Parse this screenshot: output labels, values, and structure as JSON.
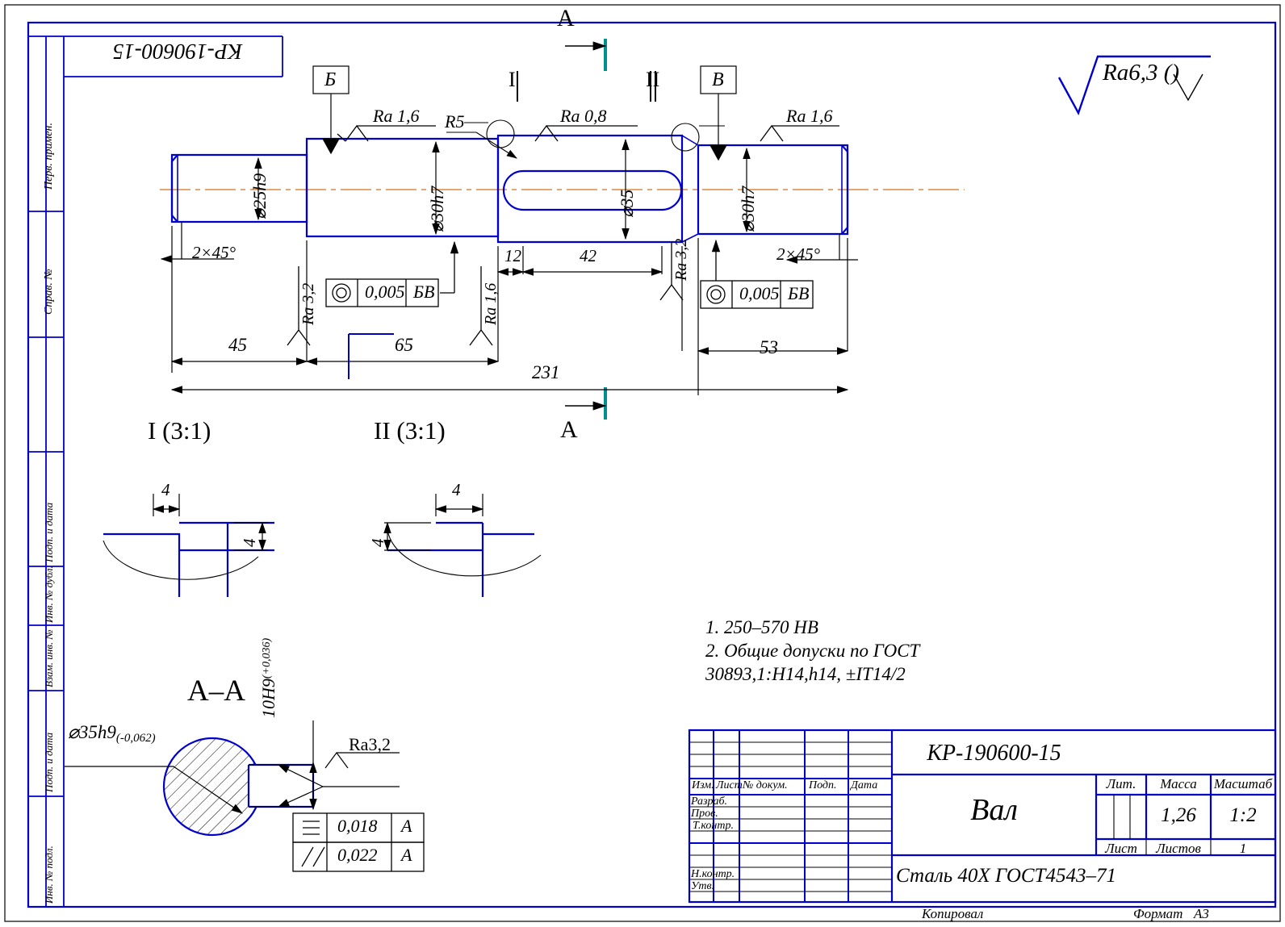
{
  "sheet": {
    "format_label": "Формат",
    "format_value": "А3",
    "copied_label": "Копировал",
    "designation_top": "КР-190600-15",
    "general_roughness": "Ra6,3 (",
    "general_roughness_suffix": ")"
  },
  "side_margin": {
    "labels": [
      "Перв. примен.",
      "Справ. №",
      "Подп. и дата",
      "Инв. № дубл.",
      "Взам. инв. №",
      "Подп. и дата",
      "Инв. № подл."
    ]
  },
  "main_view": {
    "section_marker": "А",
    "datums": [
      "Б",
      "В"
    ],
    "detail_marks": [
      "I",
      "II"
    ],
    "diameters": [
      "⌀25h9",
      "⌀30h7",
      "⌀35",
      "⌀30h7"
    ],
    "roughness": [
      "Ra 1,6",
      "Ra 0,8",
      "Ra 1,6",
      "Ra 3,2",
      "Ra 1,6",
      "Ra 3,2"
    ],
    "radius": "R5",
    "chamfers": [
      "2×45°",
      "2×45°"
    ],
    "linear_dims": [
      "45",
      "65",
      "12",
      "42",
      "53",
      "231"
    ],
    "tolerance_frames": [
      {
        "symbol": "concentricity",
        "value": "0,005",
        "datum": "БВ"
      },
      {
        "symbol": "concentricity",
        "value": "0,005",
        "datum": "БВ"
      }
    ]
  },
  "details": {
    "items": [
      {
        "title": "I (3:1)",
        "dim_h": "4",
        "dim_v": "4"
      },
      {
        "title": "II (3:1)",
        "dim_h": "4",
        "dim_v": "4"
      }
    ]
  },
  "section_aa": {
    "title": "А–А",
    "shaft_dia": "⌀35h9",
    "shaft_dia_tol": "(-0,062)",
    "key_width": "10Н9",
    "key_width_tol": "(+0,036)",
    "roughness": "Ra3,2",
    "tolerance_frames": [
      {
        "symbol": "symmetry",
        "value": "0,018",
        "datum": "А"
      },
      {
        "symbol": "parallelism",
        "value": "0,022",
        "datum": "А"
      }
    ]
  },
  "technical_requirements": {
    "lines": [
      "1.  250–570 НВ",
      "2.  Общие допуски по ГОСТ",
      "30893,1:Н14,h14,  ±IT14/2"
    ]
  },
  "title_block": {
    "designation": "КР-190600-15",
    "name": "Вал",
    "material": "Сталь 40Х ГОСТ4543–71",
    "columns_header": [
      "Изм.",
      "Лист",
      "№ докум.",
      "Подп.",
      "Дата"
    ],
    "roles": [
      "Разраб.",
      "Пров.",
      "Т.контр.",
      "Н.контр.",
      "Утв."
    ],
    "lit_label": "Лит.",
    "mass_label": "Масса",
    "scale_label": "Масштаб",
    "mass_value": "1,26",
    "scale_value": "1:2",
    "sheet_label": "Лист",
    "sheets_label": "Листов",
    "sheets_value": "1"
  },
  "colors": {
    "frame": "#0000cc",
    "outline": "#0000cc",
    "thin": "#000000",
    "centerline": "#d98a43",
    "section_mark": "#009090"
  }
}
